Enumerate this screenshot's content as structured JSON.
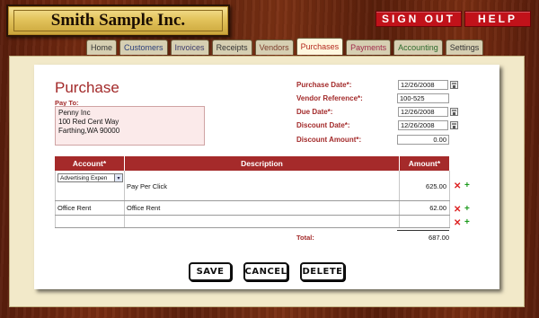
{
  "header": {
    "company": "Smith Sample Inc.",
    "signout_label": "SIGN OUT",
    "help_label": "HELP"
  },
  "tabs": [
    "Home",
    "Customers",
    "Invoices",
    "Receipts",
    "Vendors",
    "Purchases",
    "Payments",
    "Accounting",
    "Settings"
  ],
  "active_tab": "Purchases",
  "form": {
    "title": "Purchase",
    "payto_label": "Pay To:",
    "payto_value": "Penny Inc\n100 Red Cent Way\nFarthing,WA 90000",
    "purchase_date_label": "Purchase Date*:",
    "purchase_date_value": "12/26/2008",
    "vendor_ref_label": "Vendor Reference*:",
    "vendor_ref_value": "100-525",
    "due_date_label": "Due Date*:",
    "due_date_value": "12/26/2008",
    "discount_date_label": "Discount Date*:",
    "discount_date_value": "12/26/2008",
    "discount_amount_label": "Discount Amount*:",
    "discount_amount_value": "0.00"
  },
  "table": {
    "headers": {
      "account": "Account*",
      "description": "Description",
      "amount": "Amount*"
    },
    "rows": [
      {
        "account": "Advertising Expen",
        "description": "Pay Per Click",
        "amount": "625.00"
      },
      {
        "account": "Office Rent",
        "description": "Office Rent",
        "amount": "62.00"
      },
      {
        "account": "",
        "description": "",
        "amount": ""
      }
    ],
    "total_label": "Total:",
    "total_value": "687.00"
  },
  "buttons": {
    "save": "SAVE",
    "cancel": "CANCEL",
    "delete": "DELETE"
  },
  "colors": {
    "accent": "#a52a2a",
    "button_red": "#c1121a",
    "paper": "#f2e9c9",
    "wood": "#6a2610"
  }
}
